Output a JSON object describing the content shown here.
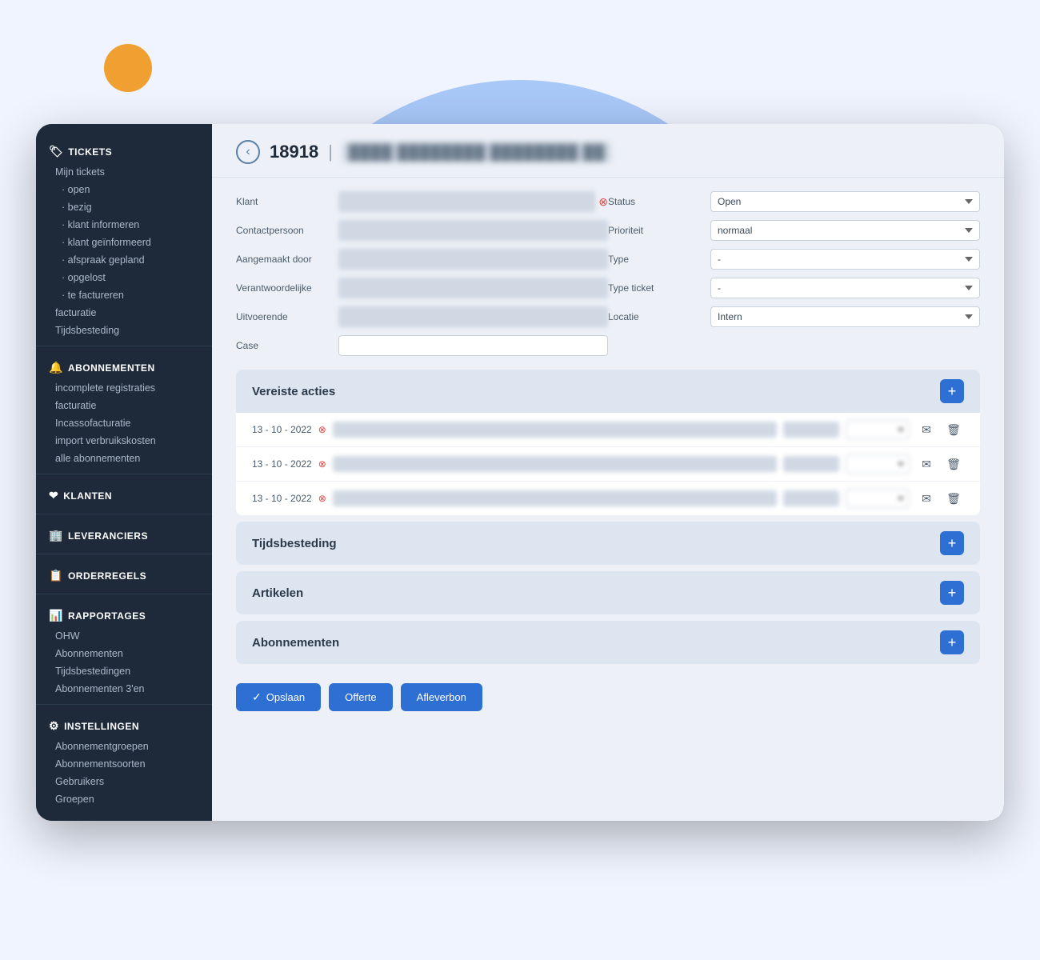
{
  "background": {
    "large_circle_color": "#a8c8f8",
    "small_circle_color": "#f0a030"
  },
  "sidebar": {
    "sections": [
      {
        "id": "tickets",
        "label": "TICKETS",
        "icon": "🏷",
        "items": [
          {
            "label": "Mijn tickets",
            "sub": false
          },
          {
            "label": "· open",
            "sub": true
          },
          {
            "label": "· bezig",
            "sub": true
          },
          {
            "label": "· klant informeren",
            "sub": true
          },
          {
            "label": "· klant geïnformeerd",
            "sub": true
          },
          {
            "label": "· afspraak gepland",
            "sub": true
          },
          {
            "label": "· opgelost",
            "sub": true
          },
          {
            "label": "· te factureren",
            "sub": true
          },
          {
            "label": "facturatie",
            "sub": false
          },
          {
            "label": "Tijdsbesteding",
            "sub": false
          }
        ]
      },
      {
        "id": "abonnementen",
        "label": "ABONNEMENTEN",
        "icon": "🔔",
        "items": [
          {
            "label": "incomplete registraties",
            "sub": false
          },
          {
            "label": "facturatie",
            "sub": false
          },
          {
            "label": "Incassofacturatie",
            "sub": false
          },
          {
            "label": "import verbruikskosten",
            "sub": false
          },
          {
            "label": "alle abonnementen",
            "sub": false
          }
        ]
      },
      {
        "id": "klanten",
        "label": "KLANTEN",
        "icon": "❤",
        "items": []
      },
      {
        "id": "leveranciers",
        "label": "LEVERANCIERS",
        "icon": "🏢",
        "items": []
      },
      {
        "id": "orderregels",
        "label": "ORDERREGELS",
        "icon": "📋",
        "items": []
      },
      {
        "id": "rapportages",
        "label": "RAPPORTAGES",
        "icon": "📊",
        "items": [
          {
            "label": "OHW",
            "sub": false
          },
          {
            "label": "Abonnementen",
            "sub": false
          },
          {
            "label": "Tijdsbestedingen",
            "sub": false
          },
          {
            "label": "Abonnementen 3'en",
            "sub": false
          }
        ]
      },
      {
        "id": "instellingen",
        "label": "INSTELLINGEN",
        "icon": "⚙",
        "items": [
          {
            "label": "Abonnementgroepen",
            "sub": false
          },
          {
            "label": "Abonnementsoorten",
            "sub": false
          },
          {
            "label": "Gebruikers",
            "sub": false
          },
          {
            "label": "Groepen",
            "sub": false
          }
        ]
      }
    ]
  },
  "header": {
    "back_label": "←",
    "ticket_number": "18918",
    "ticket_name_blurred": "████ ████████ ████████ ██"
  },
  "form": {
    "left": {
      "fields": [
        {
          "label": "Klant",
          "type": "input_blurred_with_error"
        },
        {
          "label": "Contactpersoon",
          "type": "input_blurred"
        },
        {
          "label": "Aangemaakt door",
          "type": "select_blurred"
        },
        {
          "label": "Verantwoordelijke",
          "type": "select_blurred"
        },
        {
          "label": "Uitvoerende",
          "type": "select_blurred"
        },
        {
          "label": "Case",
          "type": "input_empty"
        }
      ]
    },
    "right": {
      "fields": [
        {
          "label": "Status",
          "type": "select",
          "value": "Open"
        },
        {
          "label": "Prioriteit",
          "type": "select",
          "value": "normaal"
        },
        {
          "label": "Type",
          "type": "select",
          "value": "-"
        },
        {
          "label": "Type ticket",
          "type": "select",
          "value": "-"
        },
        {
          "label": "Locatie",
          "type": "select",
          "value": "Intern"
        }
      ]
    }
  },
  "sections": [
    {
      "id": "vereiste-acties",
      "title": "Vereiste acties",
      "add_btn": "+",
      "rows": [
        {
          "date": "13 - 10 - 2022",
          "has_error": true
        },
        {
          "date": "13 - 10 - 2022",
          "has_error": true
        },
        {
          "date": "13 - 10 - 2022",
          "has_error": true
        }
      ]
    },
    {
      "id": "tijdsbesteding",
      "title": "Tijdsbesteding",
      "add_btn": "+",
      "rows": []
    },
    {
      "id": "artikelen",
      "title": "Artikelen",
      "add_btn": "+",
      "rows": []
    },
    {
      "id": "abonnementen",
      "title": "Abonnementen",
      "add_btn": "+",
      "rows": []
    }
  ],
  "bottom_actions": {
    "save_label": "Opslaan",
    "quote_label": "Offerte",
    "delivery_label": "Afleverbon"
  }
}
